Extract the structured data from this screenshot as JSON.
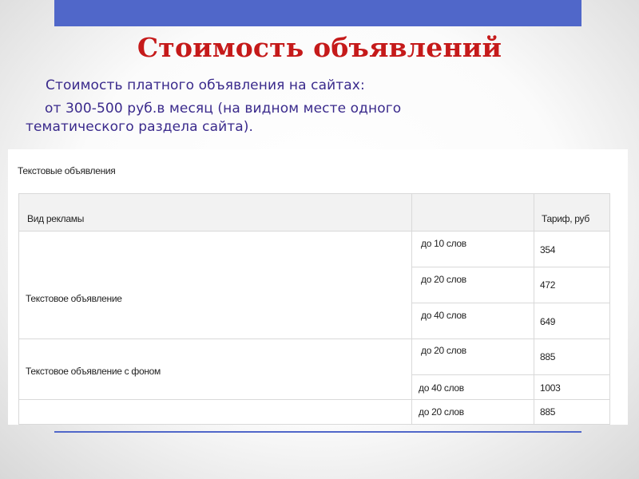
{
  "slide": {
    "title": "Стоимость объявлений",
    "subtitle_lines": [
      "Стоимость платного объявления на сайтах:",
      "от 300-500 руб.в месяц (на видном месте одного",
      "тематического раздела сайта)."
    ]
  },
  "table": {
    "title": "Текстовые объявления",
    "headers": [
      "Вид рекламы",
      "",
      "Тариф, руб"
    ],
    "groups": [
      {
        "type": "Текстовое объявление",
        "rows": [
          {
            "size": "до 10 слов",
            "price": "354"
          },
          {
            "size": "до 20 слов",
            "price": "472"
          },
          {
            "size": "до 40 слов",
            "price": "649"
          }
        ]
      },
      {
        "type": "Текстовое объявление с фоном",
        "rows": [
          {
            "size": "до 20 слов",
            "price": "885"
          },
          {
            "size": "до 40 слов",
            "price": "1003"
          }
        ]
      },
      {
        "type": "",
        "rows": [
          {
            "size": "до 20 слов",
            "price": "885"
          }
        ]
      }
    ]
  },
  "colors": {
    "accent_bar": "#5067c9",
    "title": "#c51a1a",
    "subtitle": "#3a2a8c"
  }
}
